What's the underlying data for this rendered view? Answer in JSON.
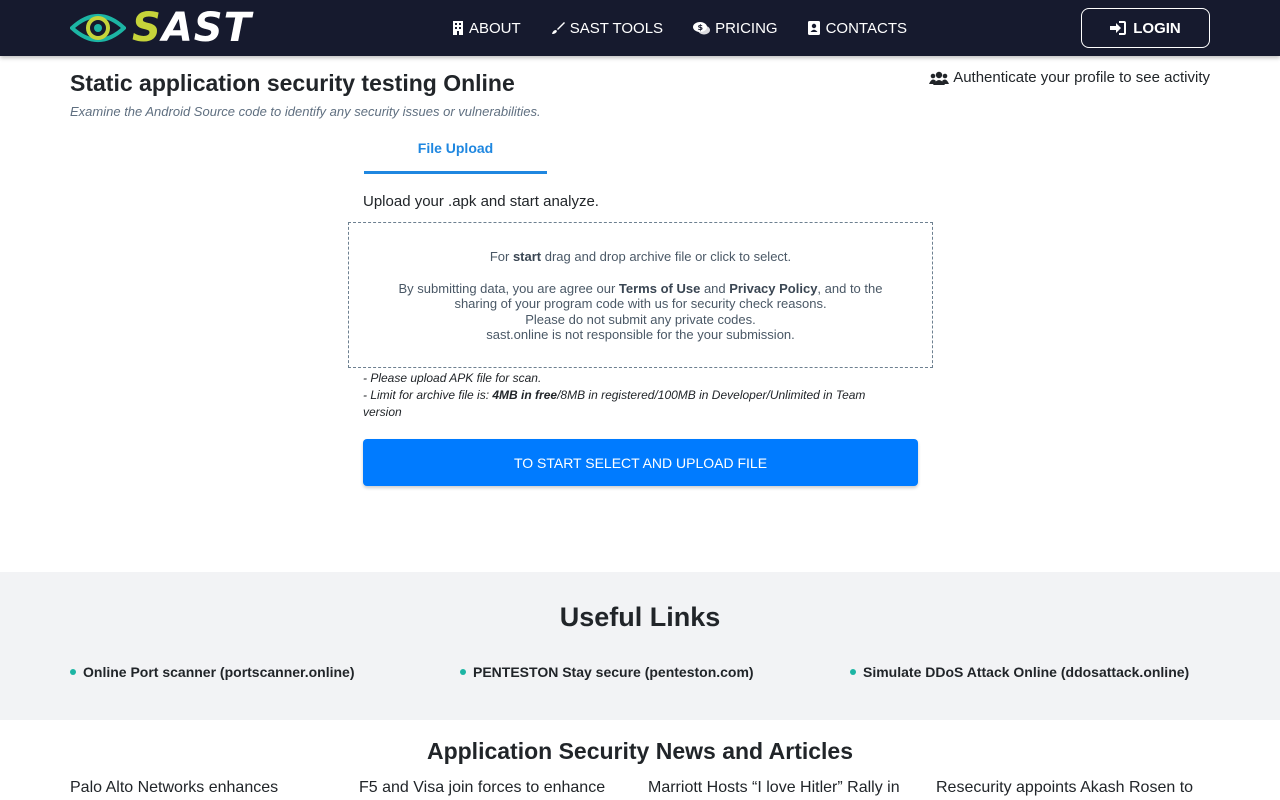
{
  "header": {
    "logo": {
      "icon": "eye-logo-icon",
      "text_first": "S",
      "text_rest": "AST",
      "accent_color": "#c6d43a",
      "teal_color": "#1cb5a4"
    },
    "nav": [
      {
        "label": "About",
        "icon": "building-icon"
      },
      {
        "label": "SAST Tools",
        "icon": "paint-brush-icon"
      },
      {
        "label": "Pricing",
        "icon": "comments-dollar-icon"
      },
      {
        "label": "Contacts",
        "icon": "address-book-icon"
      }
    ],
    "login_label": "LOGIN",
    "background": "#161a2e"
  },
  "main": {
    "title": "Static application security testing Online",
    "subtitle": "Examine the Android Source code to identify any security issues or vulnerabilities.",
    "auth_note": "Authenticate your profile to see activity",
    "tab_label": "File Upload",
    "upload_intro": "Upload your .apk and start analyze.",
    "dropzone": {
      "line1_pre": "For ",
      "line1_bold": "start",
      "line1_post": " drag and drop archive file or click to select.",
      "line2_pre": "By submitting data, you are agree our ",
      "terms": "Terms of Use",
      "and": " and ",
      "privacy": "Privacy Policy",
      "line2_post": ", and to the",
      "line3": "sharing of your program code with us for security check reasons.",
      "line4": "Please do not submit any private codes.",
      "line5": "sast.online is not responsible for the your submission."
    },
    "notes": {
      "note1": "- Please upload APK file for scan.",
      "note2_pre": "- Limit for archive file is: ",
      "note2_bold": "4MB in free",
      "note2_post": "/8MB in registered/100MB in Developer/Unlimited in Team version"
    },
    "start_button": "To start select and upload file",
    "primary_color": "#007bff",
    "tab_color": "#1f87e0"
  },
  "useful_links": {
    "title": "Useful Links",
    "items": [
      "Online Port scanner (portscanner.online)",
      "PENTESTON Stay secure (penteston.com)",
      "Simulate DDoS Attack Online (ddosattack.online)"
    ]
  },
  "news": {
    "title": "Application Security News and Articles",
    "items": [
      "Palo Alto Networks enhances",
      "F5 and Visa join forces to enhance",
      "Marriott Hosts “I love Hitler” Rally in",
      "Resecurity appoints Akash Rosen to"
    ]
  }
}
